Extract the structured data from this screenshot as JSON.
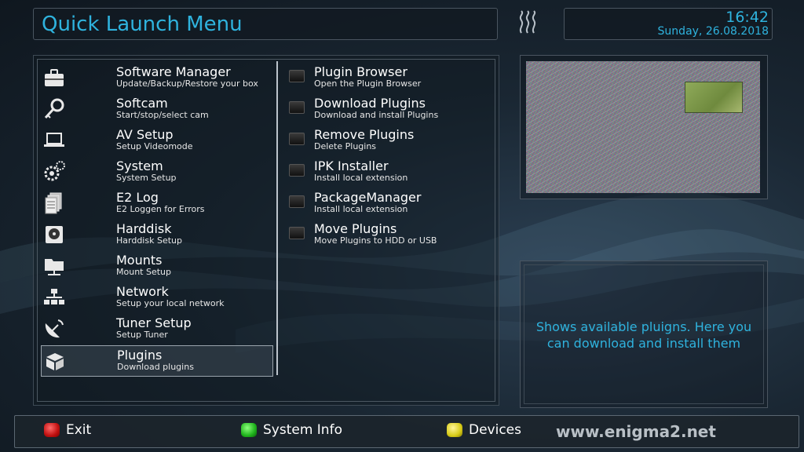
{
  "header": {
    "title": "Quick Launch Menu",
    "time": "16:42",
    "date": "Sunday, 26.08.2018"
  },
  "menu": {
    "items": [
      {
        "label": "Software Manager",
        "sub": "Update/Backup/Restore your box",
        "icon": "toolbox-icon"
      },
      {
        "label": "Softcam",
        "sub": "Start/stop/select cam",
        "icon": "key-icon"
      },
      {
        "label": "AV Setup",
        "sub": "Setup Videomode",
        "icon": "laptop-icon"
      },
      {
        "label": "System",
        "sub": "System Setup",
        "icon": "gears-icon"
      },
      {
        "label": "E2 Log",
        "sub": "E2 Loggen for Errors",
        "icon": "log-pages-icon"
      },
      {
        "label": "Harddisk",
        "sub": "Harddisk Setup",
        "icon": "harddisk-icon"
      },
      {
        "label": "Mounts",
        "sub": "Mount Setup",
        "icon": "network-folder-icon"
      },
      {
        "label": "Network",
        "sub": "Setup your local network",
        "icon": "network-icon"
      },
      {
        "label": "Tuner Setup",
        "sub": "Setup Tuner",
        "icon": "satellite-dish-icon"
      },
      {
        "label": "Plugins",
        "sub": "Download plugins",
        "icon": "plugin-box-icon"
      }
    ],
    "selected_index": 9
  },
  "plugins": {
    "items": [
      {
        "label": "Plugin Browser",
        "sub": "Open the Plugin Browser"
      },
      {
        "label": "Download Plugins",
        "sub": "Download and install Plugins"
      },
      {
        "label": "Remove Plugins",
        "sub": "Delete Plugins"
      },
      {
        "label": "IPK Installer",
        "sub": "Install local extension"
      },
      {
        "label": "PackageManager",
        "sub": "Install local extension"
      },
      {
        "label": "Move Plugins",
        "sub": "Move Plugins to HDD or USB"
      }
    ]
  },
  "description": "Shows available pluigns. Here you can download and install them",
  "footer": {
    "keys": [
      {
        "label": "Exit",
        "color": "#d61b1b"
      },
      {
        "label": "System Info",
        "color": "#22c41e"
      },
      {
        "label": "Devices",
        "color": "#e2d81c"
      }
    ],
    "watermark": "www.enigma2.net"
  },
  "colors": {
    "accent": "#2fb3de",
    "panel_border": "#5b6772"
  }
}
